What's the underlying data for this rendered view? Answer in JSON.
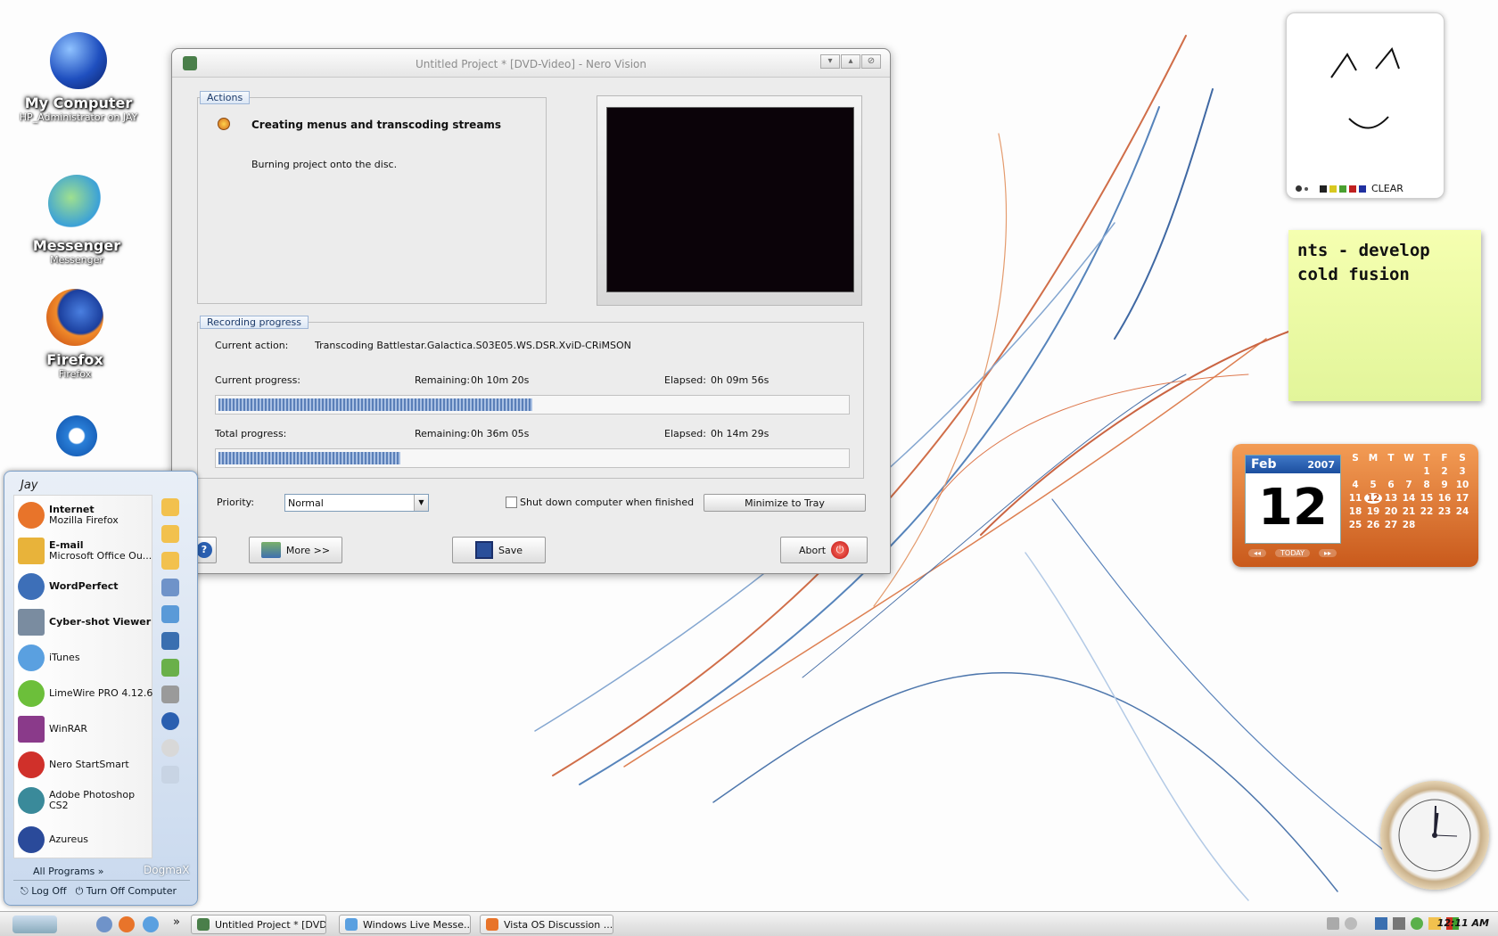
{
  "desktop_icons": [
    {
      "title": "My Computer",
      "subtitle": "HP_Administrator on JAY"
    },
    {
      "title": "Messenger",
      "subtitle": "Messenger"
    },
    {
      "title": "Firefox",
      "subtitle": "Firefox"
    }
  ],
  "window": {
    "title": "Untitled Project * [DVD-Video] - Nero Vision",
    "actions": {
      "label": "Actions",
      "current": "Creating menus and transcoding streams",
      "next": "Burning project onto the disc."
    },
    "recording": {
      "label": "Recording progress",
      "current_action_label": "Current action:",
      "current_action": "Transcoding Battlestar.Galactica.S03E05.WS.DSR.XviD-CRiMSON",
      "current_progress_label": "Current progress:",
      "current_remaining_label": "Remaining:",
      "current_remaining": "0h 10m 20s",
      "current_elapsed_label": "Elapsed:",
      "current_elapsed": "0h 09m 56s",
      "current_progress_fraction": 0.5,
      "total_progress_label": "Total progress:",
      "total_remaining_label": "Remaining:",
      "total_remaining": "0h 36m 05s",
      "total_elapsed_label": "Elapsed:",
      "total_elapsed": "0h 14m 29s",
      "total_progress_fraction": 0.29
    },
    "priority_label": "Priority:",
    "priority_value": "Normal",
    "shutdown_label": "Shut down computer when finished",
    "minimize_label": "Minimize to Tray",
    "help_label": "?",
    "more_label": "More >>",
    "save_label": "Save",
    "abort_label": "Abort"
  },
  "start_menu": {
    "user": "Jay",
    "items": [
      {
        "title": "Internet",
        "subtitle": "Mozilla Firefox",
        "color": "#e8742a"
      },
      {
        "title": "E-mail",
        "subtitle": "Microsoft Office Ou...",
        "color": "#e8b33a"
      },
      {
        "title": "WordPerfect",
        "subtitle": "",
        "color": "#3d6fb8"
      },
      {
        "title": "Cyber-shot Viewer",
        "subtitle": "",
        "color": "#7a8ca0"
      },
      {
        "title": "iTunes",
        "subtitle": "",
        "color": "#5aa0e0"
      },
      {
        "title": "LimeWire PRO 4.12.6",
        "subtitle": "",
        "color": "#6cbf3a"
      },
      {
        "title": "WinRAR",
        "subtitle": "",
        "color": "#8a3a8a"
      },
      {
        "title": "Nero StartSmart",
        "subtitle": "",
        "color": "#d0302a"
      },
      {
        "title": "Adobe Photoshop CS2",
        "subtitle": "",
        "color": "#3a8a9a"
      },
      {
        "title": "Azureus",
        "subtitle": "",
        "color": "#2a4a9a"
      }
    ],
    "all_programs": "All Programs",
    "brand": "DogmaX",
    "log_off": "Log Off",
    "turn_off": "Turn Off Computer"
  },
  "sketch_widget": {
    "clear_label": "CLEAR"
  },
  "sticky_note": {
    "text": "nts - develop cold fusion"
  },
  "calendar": {
    "month": "Feb",
    "year": "2007",
    "day": "12",
    "weekdays": [
      "S",
      "M",
      "T",
      "W",
      "T",
      "F",
      "S"
    ],
    "days": [
      "",
      "",
      "",
      "",
      "1",
      "2",
      "3",
      "4",
      "5",
      "6",
      "7",
      "8",
      "9",
      "10",
      "11",
      "12",
      "13",
      "14",
      "15",
      "16",
      "17",
      "18",
      "19",
      "20",
      "21",
      "22",
      "23",
      "24",
      "25",
      "26",
      "27",
      "28",
      "",
      "",
      ""
    ],
    "today_label": "TODAY"
  },
  "taskbar": {
    "buttons": [
      "Untitled Project * [DVD...",
      "Windows Live Messe...",
      "Vista OS Discussion ..."
    ],
    "time": "12:11 AM"
  },
  "colors": {
    "accent": "#3f78c8",
    "calendar": "#e0782e",
    "sticky": "#eefaa6"
  }
}
